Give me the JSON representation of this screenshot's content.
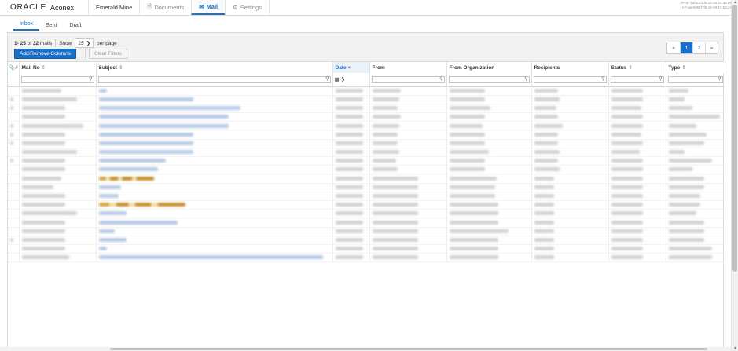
{
  "header": {
    "brand": "ORACLE",
    "product": "Aconex",
    "project": "Emerald Mine",
    "nav": [
      {
        "label": "Documents",
        "icon": "document-icon",
        "active": false
      },
      {
        "label": "Mail",
        "icon": "envelope-icon",
        "active": true
      },
      {
        "label": "Settings",
        "icon": "gear-icon",
        "active": false
      }
    ],
    "info_line1": "AP-ar-16f6c24d9-12-06 16:34:05",
    "info_line2": "AP-ap-6052f7f6-12-09 15:53:48"
  },
  "subtabs": [
    "Inbox",
    "Sent",
    "Draft"
  ],
  "toolbar": {
    "range": "1- 25",
    "of": "of",
    "total": "32",
    "mails": "mails",
    "show": "Show",
    "per_page_value": "25",
    "per_page": "per page",
    "add_remove": "Add/Remove Columns",
    "clear_filters": "Clear Filters"
  },
  "pagination": {
    "prev": "«",
    "pages": [
      "1",
      "2"
    ],
    "current": "1",
    "next": "»"
  },
  "columns": [
    "Mail No",
    "Subject",
    "Date",
    "From",
    "From Organization",
    "Recipients",
    "Status",
    "Type"
  ],
  "sorted_column": "Date",
  "colors": {
    "accent": "#1a6fc9",
    "blur_text": "#d3d3d3",
    "blur_link": "#b9cbe6"
  }
}
